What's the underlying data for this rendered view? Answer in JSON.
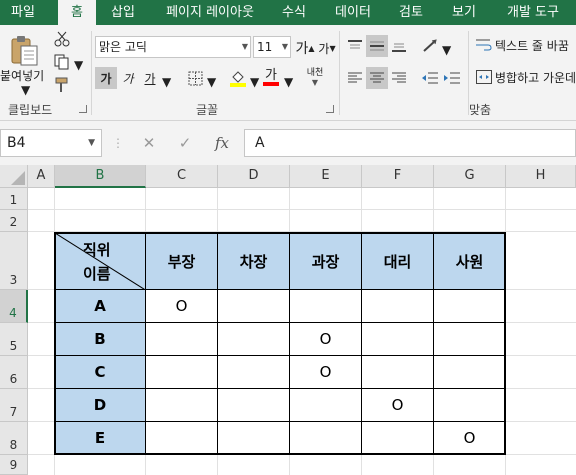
{
  "ribbon": {
    "tabs": [
      "파일",
      "홈",
      "삽입",
      "페이지 레이아웃",
      "수식",
      "데이터",
      "검토",
      "보기",
      "개발 도구"
    ],
    "active_tab": "홈",
    "clipboard": {
      "paste_label": "붙여넣기",
      "group_label": "클립보드"
    },
    "font": {
      "name": "맑은 고딕",
      "size": "11",
      "group_label": "글꼴",
      "bold": "가",
      "italic": "가",
      "underline": "가",
      "grow": "가",
      "shrink": "가",
      "font_color_sample": "가",
      "phonetic": "내천"
    },
    "alignment": {
      "wrap_text": "텍스트 줄 바꿈",
      "merge_center": "병합하고 가운데",
      "group_label": "맞춤"
    },
    "colors": {
      "brand": "#217346",
      "font_color_bar": "#ff0000",
      "fill_color_bar": "#ffff00"
    }
  },
  "formula_bar": {
    "name_box": "B4",
    "formula": "A",
    "fx": "fx"
  },
  "sheet": {
    "columns": [
      "A",
      "B",
      "C",
      "D",
      "E",
      "F",
      "G",
      "H"
    ],
    "rows": [
      "1",
      "2",
      "3",
      "4",
      "5",
      "6",
      "7",
      "8",
      "9"
    ],
    "selected_cell": "B4"
  },
  "table": {
    "corner_top": "직위",
    "corner_bottom": "이름",
    "header": [
      "부장",
      "차장",
      "과장",
      "대리",
      "사원"
    ],
    "rows": [
      {
        "name": "A",
        "cells": [
          "O",
          "",
          "",
          "",
          ""
        ]
      },
      {
        "name": "B",
        "cells": [
          "",
          "",
          "O",
          "",
          ""
        ]
      },
      {
        "name": "C",
        "cells": [
          "",
          "",
          "O",
          "",
          ""
        ]
      },
      {
        "name": "D",
        "cells": [
          "",
          "",
          "",
          "O",
          ""
        ]
      },
      {
        "name": "E",
        "cells": [
          "",
          "",
          "",
          "",
          "O"
        ]
      }
    ],
    "header_fill": "#bdd7ee"
  }
}
